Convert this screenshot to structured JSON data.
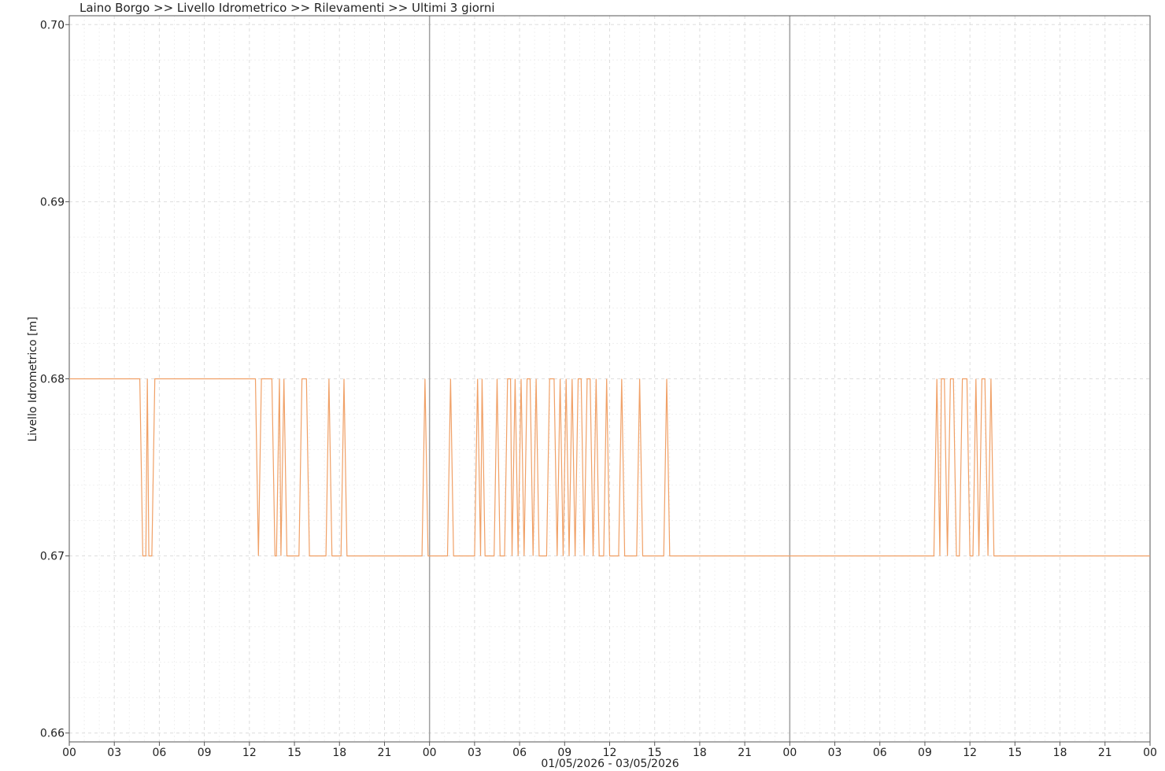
{
  "chart_data": {
    "type": "line",
    "title": "Laino Borgo >> Livello Idrometrico >> Rilevamenti >> Ultimi 3 giorni",
    "xlabel": "01/05/2026 - 03/05/2026",
    "ylabel": "Livello Idrometrico [m]",
    "xlim": [
      0,
      72
    ],
    "ylim": [
      0.6595,
      0.7005
    ],
    "y_ticks": [
      "0.66",
      "0.67",
      "0.68",
      "0.69",
      "0.70"
    ],
    "y_tick_values": [
      0.66,
      0.67,
      0.68,
      0.69,
      0.7
    ],
    "x_ticks": [
      "00",
      "03",
      "06",
      "09",
      "12",
      "15",
      "18",
      "21",
      "00",
      "03",
      "06",
      "09",
      "12",
      "15",
      "18",
      "21",
      "00",
      "03",
      "06",
      "09",
      "12",
      "15",
      "18",
      "21",
      "00"
    ],
    "x_tick_hours": [
      0,
      3,
      6,
      9,
      12,
      15,
      18,
      21,
      24,
      27,
      30,
      33,
      36,
      39,
      42,
      45,
      48,
      51,
      54,
      57,
      60,
      63,
      66,
      69,
      72
    ],
    "day_separators_hours": [
      24,
      48
    ],
    "grid": true,
    "colors": {
      "series": "#f0a066",
      "day_line": "#a0a0a0",
      "grid": "#dddddd",
      "axis": "#555555"
    },
    "series": [
      {
        "points": [
          [
            0,
            0.68
          ],
          [
            4.7,
            0.68
          ],
          [
            4.9,
            0.67
          ],
          [
            5.1,
            0.67
          ],
          [
            5.2,
            0.68
          ],
          [
            5.3,
            0.67
          ],
          [
            5.5,
            0.67
          ],
          [
            5.7,
            0.68
          ],
          [
            12.4,
            0.68
          ],
          [
            12.6,
            0.67
          ],
          [
            12.8,
            0.68
          ],
          [
            13.5,
            0.68
          ],
          [
            13.7,
            0.67
          ],
          [
            13.8,
            0.67
          ],
          [
            14.0,
            0.68
          ],
          [
            14.1,
            0.67
          ],
          [
            14.3,
            0.68
          ],
          [
            14.5,
            0.67
          ],
          [
            15.3,
            0.67
          ],
          [
            15.5,
            0.68
          ],
          [
            15.8,
            0.68
          ],
          [
            16.0,
            0.67
          ],
          [
            17.1,
            0.67
          ],
          [
            17.3,
            0.68
          ],
          [
            17.5,
            0.67
          ],
          [
            18.1,
            0.67
          ],
          [
            18.3,
            0.68
          ],
          [
            18.5,
            0.67
          ],
          [
            23.5,
            0.67
          ],
          [
            23.7,
            0.68
          ],
          [
            23.9,
            0.67
          ],
          [
            25.2,
            0.67
          ],
          [
            25.4,
            0.68
          ],
          [
            25.6,
            0.67
          ],
          [
            27.0,
            0.67
          ],
          [
            27.2,
            0.68
          ],
          [
            27.4,
            0.67
          ],
          [
            27.5,
            0.68
          ],
          [
            27.7,
            0.67
          ],
          [
            28.3,
            0.67
          ],
          [
            28.5,
            0.68
          ],
          [
            28.7,
            0.67
          ],
          [
            29.0,
            0.67
          ],
          [
            29.2,
            0.68
          ],
          [
            29.4,
            0.68
          ],
          [
            29.5,
            0.67
          ],
          [
            29.7,
            0.68
          ],
          [
            29.9,
            0.67
          ],
          [
            30.1,
            0.68
          ],
          [
            30.3,
            0.67
          ],
          [
            30.5,
            0.68
          ],
          [
            30.7,
            0.68
          ],
          [
            30.9,
            0.67
          ],
          [
            31.1,
            0.68
          ],
          [
            31.3,
            0.67
          ],
          [
            31.8,
            0.67
          ],
          [
            32.0,
            0.68
          ],
          [
            32.3,
            0.68
          ],
          [
            32.5,
            0.67
          ],
          [
            32.7,
            0.68
          ],
          [
            32.9,
            0.67
          ],
          [
            33.1,
            0.68
          ],
          [
            33.3,
            0.67
          ],
          [
            33.5,
            0.68
          ],
          [
            33.7,
            0.67
          ],
          [
            33.9,
            0.68
          ],
          [
            34.1,
            0.68
          ],
          [
            34.3,
            0.67
          ],
          [
            34.5,
            0.68
          ],
          [
            34.7,
            0.68
          ],
          [
            34.9,
            0.67
          ],
          [
            35.1,
            0.68
          ],
          [
            35.3,
            0.67
          ],
          [
            35.6,
            0.67
          ],
          [
            35.8,
            0.68
          ],
          [
            36.0,
            0.67
          ],
          [
            36.6,
            0.67
          ],
          [
            36.8,
            0.68
          ],
          [
            37.0,
            0.67
          ],
          [
            37.8,
            0.67
          ],
          [
            38.0,
            0.68
          ],
          [
            38.2,
            0.67
          ],
          [
            39.6,
            0.67
          ],
          [
            39.8,
            0.68
          ],
          [
            40.0,
            0.67
          ],
          [
            57.6,
            0.67
          ],
          [
            57.8,
            0.68
          ],
          [
            58.0,
            0.67
          ],
          [
            58.1,
            0.68
          ],
          [
            58.3,
            0.68
          ],
          [
            58.5,
            0.67
          ],
          [
            58.7,
            0.68
          ],
          [
            58.9,
            0.68
          ],
          [
            59.1,
            0.67
          ],
          [
            59.3,
            0.67
          ],
          [
            59.5,
            0.68
          ],
          [
            59.8,
            0.68
          ],
          [
            60.0,
            0.67
          ],
          [
            60.2,
            0.67
          ],
          [
            60.4,
            0.68
          ],
          [
            60.6,
            0.67
          ],
          [
            60.8,
            0.68
          ],
          [
            61.0,
            0.68
          ],
          [
            61.2,
            0.67
          ],
          [
            61.4,
            0.68
          ],
          [
            61.6,
            0.67
          ],
          [
            72,
            0.67
          ]
        ]
      }
    ]
  }
}
